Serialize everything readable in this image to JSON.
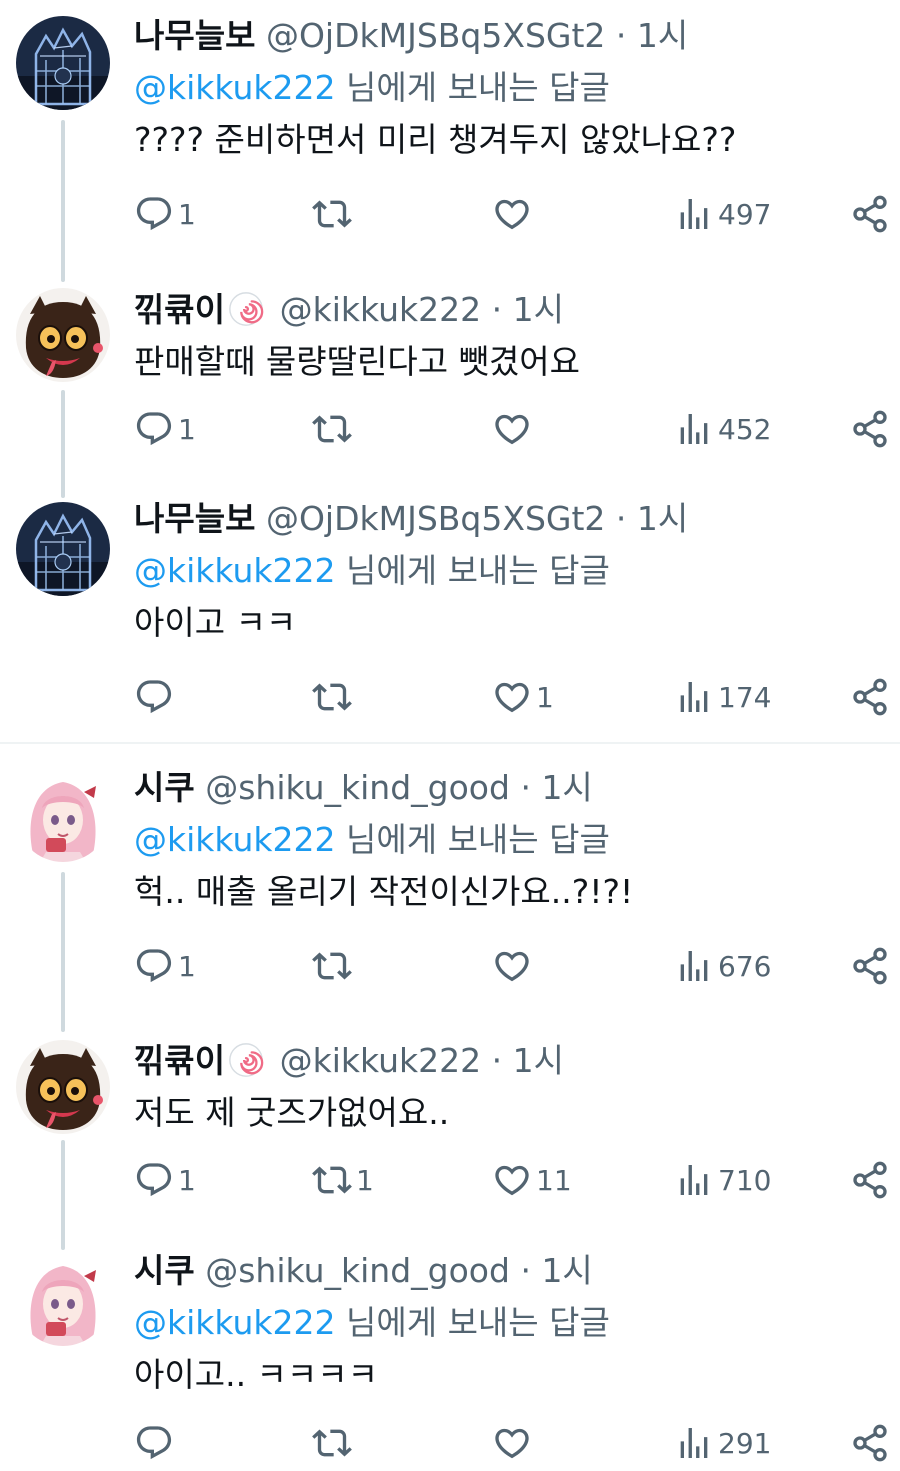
{
  "tweets": [
    {
      "name": "나무늘보",
      "handle": "@OjDkMJSBq5XSGt2",
      "time": "1시",
      "reply_to": "@kikkuk222",
      "reply_suffix": "님에게 보내는 답글",
      "text": "???? 준비하면서 미리 챙겨두지 않았나요??",
      "replies": "1",
      "retweets": "",
      "likes": "",
      "views": "497"
    },
    {
      "name": "끾큒이",
      "handle": "@kikkuk222",
      "time": "1시",
      "text": "판매할때 물량딸린다고 뺏겼어요",
      "replies": "1",
      "retweets": "",
      "likes": "",
      "views": "452"
    },
    {
      "name": "나무늘보",
      "handle": "@OjDkMJSBq5XSGt2",
      "time": "1시",
      "reply_to": "@kikkuk222",
      "reply_suffix": "님에게 보내는 답글",
      "text": "아이고 ㅋㅋ",
      "replies": "",
      "retweets": "",
      "likes": "1",
      "views": "174"
    },
    {
      "name": "시쿠",
      "handle": "@shiku_kind_good",
      "time": "1시",
      "reply_to": "@kikkuk222",
      "reply_suffix": "님에게 보내는 답글",
      "text": "헉.. 매출 올리기 작전이신가요..?!?!",
      "replies": "1",
      "retweets": "",
      "likes": "",
      "views": "676"
    },
    {
      "name": "끾큒이",
      "handle": "@kikkuk222",
      "time": "1시",
      "text": "저도 제 굿즈가없어요..",
      "replies": "1",
      "retweets": "1",
      "likes": "11",
      "views": "710"
    },
    {
      "name": "시쿠",
      "handle": "@shiku_kind_good",
      "time": "1시",
      "reply_to": "@kikkuk222",
      "reply_suffix": "님에게 보내는 답글",
      "text": "아이고.. ㅋㅋㅋㅋ",
      "replies": "",
      "retweets": "",
      "likes": "",
      "views": "291"
    }
  ],
  "separator_dot": "·",
  "icons": {
    "reply": "reply-icon",
    "retweet": "retweet-icon",
    "like": "heart-icon",
    "views": "views-icon",
    "share": "share-icon",
    "badge": "narutomaki-badge-icon"
  },
  "colors": {
    "text": "#0f1419",
    "muted": "#536471",
    "link": "#1d9bf0",
    "thread_line": "#cfd9de",
    "divider": "#eff3f4"
  }
}
